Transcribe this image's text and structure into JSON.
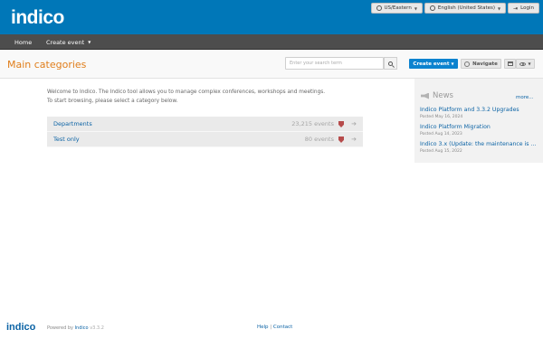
{
  "header": {
    "logo": "indico",
    "timezone": "US/Eastern",
    "language": "English (United States)",
    "login": "Login"
  },
  "nav": {
    "items": [
      {
        "label": "Home"
      },
      {
        "label": "Create event"
      }
    ]
  },
  "titlebar": {
    "title": "Main categories",
    "search_placeholder": "Enter your search term",
    "create_event": "Create event",
    "navigate": "Navigate"
  },
  "main": {
    "welcome_line1": "Welcome to Indico. The Indico tool allows you to manage complex conferences, workshops and meetings.",
    "welcome_line2": "To start browsing, please select a category below.",
    "categories": [
      {
        "name": "Departments",
        "count": "23,215 events"
      },
      {
        "name": "Test only",
        "count": "80 events"
      }
    ]
  },
  "news": {
    "title": "News",
    "more": "more...",
    "items": [
      {
        "title": "Indico Platform and 3.3.2 Upgrades",
        "date": "Posted May 16, 2024"
      },
      {
        "title": "Indico Platform Migration",
        "date": "Posted Aug 14, 2023"
      },
      {
        "title": "Indico 3.x (Update: the maintenance is n...",
        "date": "Posted Aug 15, 2022"
      }
    ]
  },
  "footer": {
    "logo": "indico",
    "powered_by": "Powered by",
    "indico_link": "Indico",
    "version": "v3.3.2",
    "help": "Help",
    "separator": "|",
    "contact": "Contact"
  },
  "colors": {
    "header_bg": "#0077b8",
    "nav_bg": "#4d4d4d",
    "title_color": "#e07e1b",
    "link_color": "#0b63a5",
    "primary_button": "#0c83cf"
  }
}
